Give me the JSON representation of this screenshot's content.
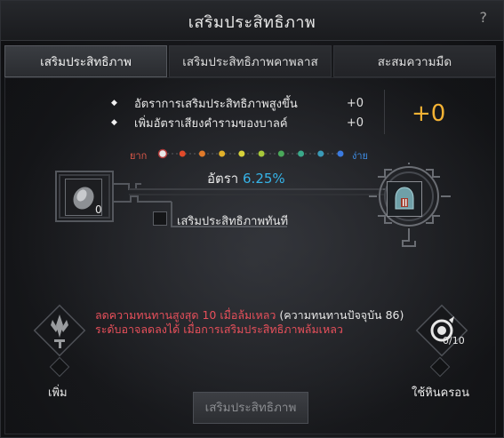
{
  "window": {
    "title": "เสริมประสิทธิภาพ",
    "help": "?"
  },
  "tabs": [
    {
      "label": "เสริมประสิทธิภาพ",
      "active": true
    },
    {
      "label": "เสริมประสิทธิภาพคาพลาส",
      "active": false
    },
    {
      "label": "สะสมความมืด",
      "active": false
    }
  ],
  "bonuses": [
    {
      "text": "อัตราการเสริมประสิทธิภาพสูงขึ้น",
      "value": "+0"
    },
    {
      "text": "เพิ่มอัตราเสียงคำรามของบาลค์",
      "value": "+0"
    }
  ],
  "bonus_total": "+0",
  "difficulty": {
    "left": "ยาก",
    "right": "ง่าย",
    "dot_colors": [
      "#e8e8e8",
      "#e04a2a",
      "#e07a2a",
      "#e0b02a",
      "#d8d23a",
      "#a8c83a",
      "#4aa85a",
      "#3aa88a",
      "#3a9ab8",
      "#3a7ae0"
    ]
  },
  "rate": {
    "label": "อัตรา",
    "value": "6.25%"
  },
  "item_count": "0",
  "instant_enhance_label": "เสริมประสิทธิภาพทันที",
  "warning": {
    "line1_red": "ลดความทนทานสูงสุด 10 เมื่อล้มเหลว",
    "line1_white": " (ความทนทานปัจจุบัน 86)",
    "line2_red": "ระดับอาจลดลงได้ เมื่อการเสริมประสิทธิภาพล้มเหลว"
  },
  "left_button": {
    "label": "เพิ่ม"
  },
  "right_button": {
    "label": "ใช้หินครอน",
    "count": "0/10"
  },
  "enhance_button": "เสริมประสิทธิภาพ",
  "colors": {
    "accent_gold": "#f3b234",
    "rate_blue": "#36b4e8",
    "warn_red": "#e8505b"
  }
}
